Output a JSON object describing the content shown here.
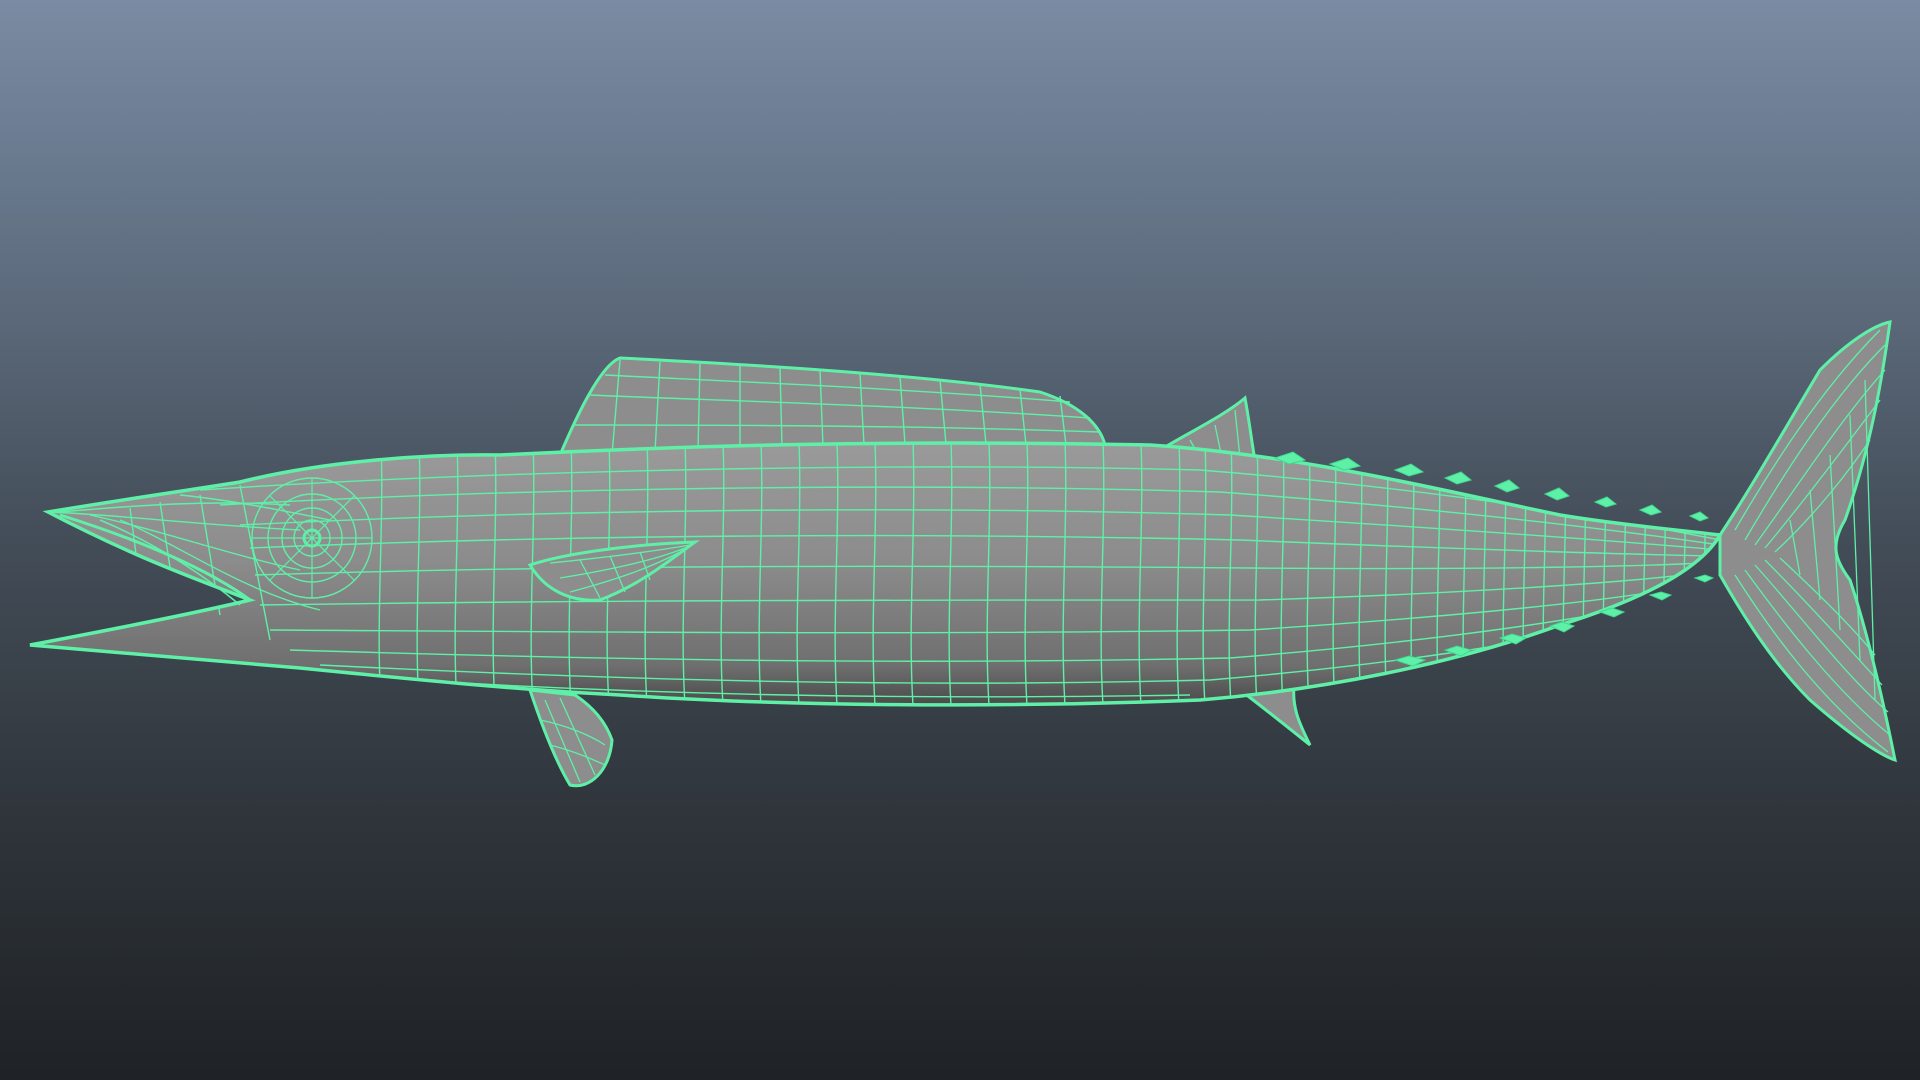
{
  "viewport": {
    "object": "fish-model",
    "display_mode": "wireframe-on-shaded",
    "background": {
      "top": "#7a8ba3",
      "bottom": "#1f2226"
    },
    "wire_color": "#5ff0a8",
    "shade_color": "#8a8a8a"
  }
}
